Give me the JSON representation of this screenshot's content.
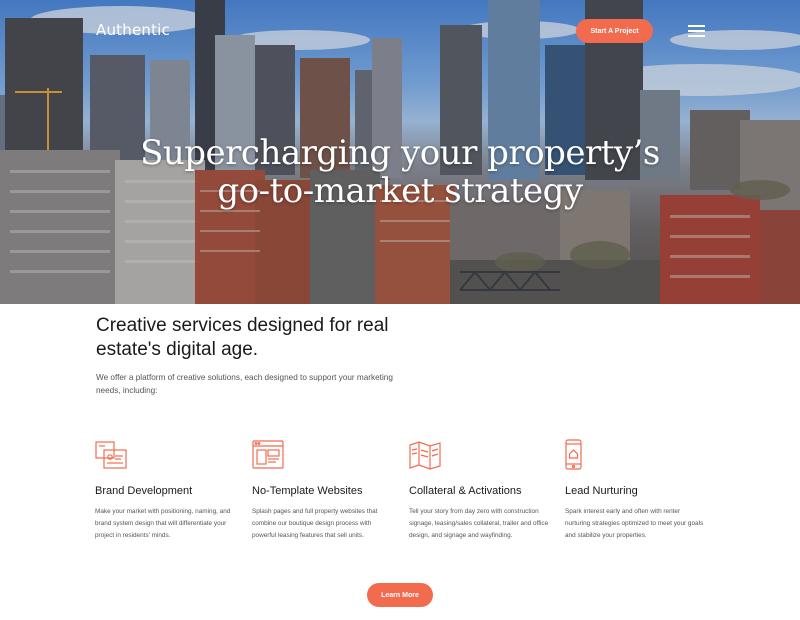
{
  "header": {
    "logo": "Authentic",
    "cta_label": "Start A Project"
  },
  "hero": {
    "headline_line1": "Supercharging your property’s",
    "headline_line2": "go-to-market strategy"
  },
  "main": {
    "title": "Creative services designed for real estate's digital age.",
    "intro": "We offer a platform of creative solutions, each designed to support your marketing needs, including:",
    "services": [
      {
        "icon": "brand-id-card-icon",
        "title": "Brand Development",
        "description": "Make your market with positioning, naming, and brand system design that will differentiate your project in residents' minds."
      },
      {
        "icon": "website-browser-icon",
        "title": "No-Template Websites",
        "description": "Splash pages and full property websites that combine our boutique design process with powerful leasing features that sell units."
      },
      {
        "icon": "folded-map-icon",
        "title": "Collateral & Activations",
        "description": "Tell your story from day zero with construction signage, leasing/sales collateral, trailer and office design, and signage and wayfinding."
      },
      {
        "icon": "mobile-phone-home-icon",
        "title": "Lead Nurturing",
        "description": "Spark interest early and often with renter nurturing strategies optimized to meet your goals and stabilize your properties."
      }
    ],
    "learn_more_label": "Learn More"
  },
  "colors": {
    "accent": "#f26b4f",
    "text_dark": "#1a1a1a",
    "text_muted": "#555555"
  }
}
